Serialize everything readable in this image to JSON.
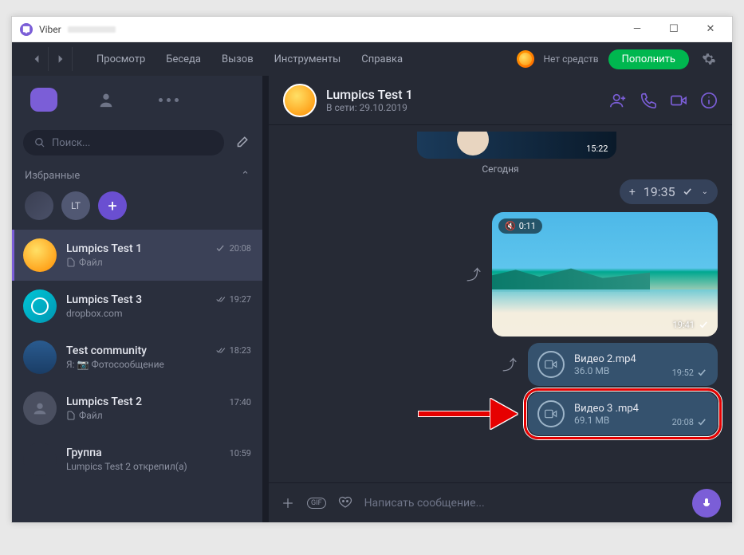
{
  "window": {
    "title": "Viber"
  },
  "topbar": {
    "menus": [
      "Просмотр",
      "Беседа",
      "Вызов",
      "Инструменты",
      "Справка"
    ],
    "balance": "Нет средств",
    "topup": "Пополнить"
  },
  "sidebar": {
    "search_placeholder": "Поиск...",
    "favorites_label": "Избранные",
    "fav_badge": "LT",
    "chats": [
      {
        "name": "Lumpics Test 1",
        "sub": "Файл",
        "time": "20:08",
        "check": "single",
        "icon": "file"
      },
      {
        "name": "Lumpics Test 3",
        "sub": "dropbox.com",
        "time": "19:27",
        "check": "double",
        "icon": "none"
      },
      {
        "name": "Test community",
        "sub": "Я: 📷 Фотосообщение",
        "time": "18:23",
        "check": "double",
        "icon": "none"
      },
      {
        "name": "Lumpics Test 2",
        "sub": "Файл",
        "time": "17:40",
        "check": "none",
        "icon": "file"
      },
      {
        "name": "Группа",
        "sub": "Lumpics Test 2 открепил(а)",
        "time": "10:59",
        "check": "none",
        "icon": "none"
      }
    ]
  },
  "chat": {
    "name": "Lumpics Test 1",
    "status": "В сети: 29.10.2019",
    "date": "Сегодня",
    "old_time": "15:22",
    "collapsed_time": "19:35",
    "video_duration": "0:11",
    "video_time": "19:41",
    "files": [
      {
        "name": "Видео 2.mp4",
        "size": "36.0 MB",
        "time": "19:52"
      },
      {
        "name": "Видео 3 .mp4",
        "size": "69.1 MB",
        "time": "20:08"
      }
    ],
    "composer_placeholder": "Написать сообщение...",
    "gif": "GIF"
  }
}
